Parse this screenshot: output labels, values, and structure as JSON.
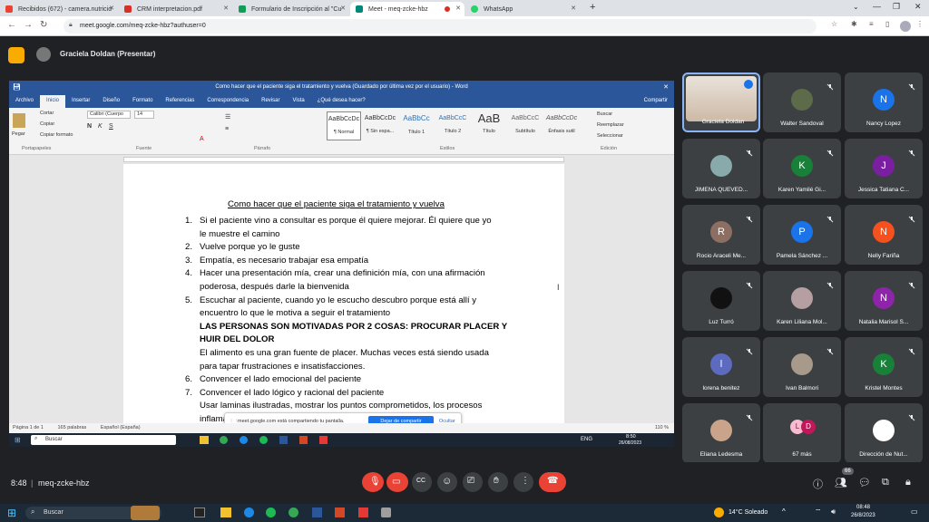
{
  "browser": {
    "tabs": [
      {
        "label": "Recibidos (672) - camera.nutricio",
        "color": "#ea4335"
      },
      {
        "label": "CRM interpretacion.pdf",
        "color": "#d93025"
      },
      {
        "label": "Formulario de Inscripción al \"Cu",
        "color": "#0f9d58"
      },
      {
        "label": "Meet - meq-zcke-hbz",
        "color": "#00897b"
      },
      {
        "label": "WhatsApp",
        "color": "#25d366"
      }
    ],
    "url": "meet.google.com/meq-zcke-hbz?authuser=0"
  },
  "meet": {
    "presenter_label": "Graciela Doldan (Presentar)",
    "time": "8:48",
    "separator": "|",
    "meeting_code": "meq-zcke-hbz",
    "people_badge": "66",
    "participants": [
      {
        "name": "Graciela Doldan",
        "initial": "",
        "color": "#e8d5c4"
      },
      {
        "name": "Walter Sandoval",
        "initial": "",
        "color": "#5d6b4a"
      },
      {
        "name": "Nancy Lopez",
        "initial": "N",
        "color": "#1a73e8"
      },
      {
        "name": "JIMENA QUEVED...",
        "initial": "",
        "color": "#8aa"
      },
      {
        "name": "Karen Yamilé Gi...",
        "initial": "K",
        "color": "#188038"
      },
      {
        "name": "Jessica Tatiana C...",
        "initial": "J",
        "color": "#7b1fa2"
      },
      {
        "name": "Rocio Araceli Me...",
        "initial": "R",
        "color": "#8d6e63"
      },
      {
        "name": "Pamela Sánchez ...",
        "initial": "P",
        "color": "#1a73e8"
      },
      {
        "name": "Nelly Fariña",
        "initial": "N",
        "color": "#f4511e"
      },
      {
        "name": "Luz Turró",
        "initial": "",
        "color": "#111"
      },
      {
        "name": "Karen Liliana Mol...",
        "initial": "",
        "color": "#b59fa0"
      },
      {
        "name": "Natalia Marisol S...",
        "initial": "N",
        "color": "#8e24aa"
      },
      {
        "name": "lorena benitez",
        "initial": "l",
        "color": "#5c6bc0"
      },
      {
        "name": "Ivan Balmori",
        "initial": "",
        "color": "#a89a8a"
      },
      {
        "name": "Kristel Montes",
        "initial": "K",
        "color": "#188038"
      },
      {
        "name": "Eliana Ledesma",
        "initial": "",
        "color": "#c9a38a"
      },
      {
        "name": "67 más",
        "initial": "",
        "color": "#3c4043"
      },
      {
        "name": "Dirección de Nut...",
        "initial": "",
        "color": "#fff"
      }
    ],
    "more_initials": [
      "L",
      "D"
    ]
  },
  "word": {
    "title": "Como hacer que el paciente siga el tratamiento y vuelva (Guardado por última vez por el usuario) - Word",
    "menu": [
      "Archivo",
      "Inicio",
      "Insertar",
      "Diseño",
      "Formato",
      "Referencias",
      "Correspondencia",
      "Revisar",
      "Vista",
      "¿Qué desea hacer?"
    ],
    "share": "Compartir",
    "ribbon": {
      "paste": "Pegar",
      "cut": "Cortar",
      "copy": "Copiar",
      "format_painter": "Copiar formato",
      "clipboard": "Portapapeles",
      "font_name": "Calibri (Cuerpo",
      "font_size": "14",
      "font": "Fuente",
      "paragraph": "Párrafo",
      "styles_label": "Estilos",
      "styles": [
        {
          "preview": "AaBbCcDc",
          "name": "¶ Normal"
        },
        {
          "preview": "AaBbCcDc",
          "name": "¶ Sin espa..."
        },
        {
          "preview": "AaBbCc",
          "name": "Título 1"
        },
        {
          "preview": "AaBbCcC",
          "name": "Título 2"
        },
        {
          "preview": "AaB",
          "name": "Título"
        },
        {
          "preview": "AaBbCcC",
          "name": "Subtítulo"
        },
        {
          "preview": "AaBbCcDc",
          "name": "Énfasis sutil"
        }
      ],
      "find": "Buscar",
      "replace": "Reemplazar",
      "select": "Seleccionar",
      "editing": "Edición"
    },
    "doc": {
      "title": "Como hacer que el paciente siga el tratamiento y vuelva",
      "lines": [
        {
          "num": "1.",
          "text": "Si el paciente vino a consultar es porque él quiere mejorar. Él quiere que yo",
          "bold": false
        },
        {
          "num": "",
          "text": "le muestre el camino",
          "bold": false
        },
        {
          "num": "2.",
          "text": "Vuelve porque yo le guste",
          "bold": false
        },
        {
          "num": "3.",
          "text": "Empatía, es necesario trabajar esa empatía",
          "bold": false
        },
        {
          "num": "4.",
          "text": "Hacer una presentación mía, crear una definición mía, con una afirmación",
          "bold": false
        },
        {
          "num": "",
          "text": "poderosa, después darle la bienvenida",
          "bold": false
        },
        {
          "num": "5.",
          "text": "Escuchar al paciente, cuando yo le escucho descubro porque está allí y",
          "bold": false
        },
        {
          "num": "",
          "text": "encuentro lo que le motiva a seguir el tratamiento",
          "bold": false
        },
        {
          "num": "",
          "text": "LAS PERSONAS SON MOTIVADAS POR 2 COSAS: PROCURAR PLACER Y",
          "bold": true
        },
        {
          "num": "",
          "text": "HUIR DEL DOLOR",
          "bold": true
        },
        {
          "num": "",
          "text": "El alimento es una gran fuente de placer. Muchas veces está siendo usada",
          "bold": false
        },
        {
          "num": "",
          "text": "para tapar frustraciones e insatisfacciones.",
          "bold": false
        },
        {
          "num": "6.",
          "text": "Convencer el lado emocional del paciente",
          "bold": false
        },
        {
          "num": "7.",
          "text": "Convencer el lado lógico y racional del paciente",
          "bold": false
        },
        {
          "num": "",
          "text": "Usar laminas ilustradas, mostrar los puntos comprometidos, los procesos",
          "bold": false
        },
        {
          "num": "",
          "text": "inflamatorios ... las acciones",
          "bold": false
        }
      ]
    },
    "status": {
      "page": "Página 1 de 1",
      "words": "165 palabras",
      "lang": "Español (España)",
      "zoom": "110 %"
    },
    "share_notice": {
      "text": "meet.google.com está compartiendo tu pantalla.",
      "stop": "Dejar de compartir",
      "hide": "Ocultar"
    },
    "inner_taskbar": {
      "search": "Buscar",
      "lang": "ENG",
      "time": "8:50",
      "date": "26/08/2023"
    }
  },
  "windows": {
    "search": "Buscar",
    "weather": "14°C  Soleado",
    "time": "08:48",
    "date": "26/8/2023"
  }
}
